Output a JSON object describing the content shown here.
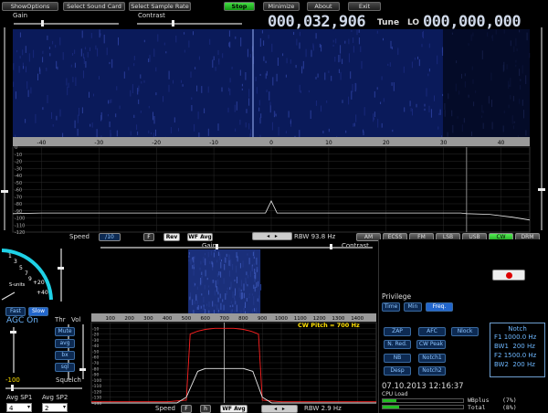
{
  "toolbar": {
    "show_options": "ShowOptions",
    "select_sound_card": "Select Sound Card",
    "select_sample_rate": "Select Sample Rate",
    "stop": "Stop",
    "minimize": "Minimize",
    "about": "About",
    "exit": "Exit"
  },
  "top": {
    "gain_label": "Gain",
    "contrast_label": "Contrast",
    "tune_value": "000,032,906",
    "tune_label": "Tune",
    "lo_label": "LO",
    "lo_value": "000,000,000"
  },
  "main_axis_labels": [
    "-40",
    "-30",
    "-20",
    "-10",
    "0",
    "10",
    "20",
    "30",
    "40"
  ],
  "main_db_labels": [
    "0",
    "-10",
    "-20",
    "-30",
    "-40",
    "-50",
    "-60",
    "-70",
    "-80",
    "-90",
    "-100",
    "-110",
    "-120"
  ],
  "mid": {
    "speed_label": "Speed",
    "speed_value": "/10",
    "f_label": "F",
    "rev_label": "Rev",
    "wfavg_label": "WF Avg",
    "rbw_label": "RBW 93.8 Hz"
  },
  "modes": [
    "AM",
    "ECSS",
    "FM",
    "LSB",
    "USB",
    "CW",
    "DRM"
  ],
  "active_mode": "CW",
  "lower": {
    "gain_label": "Gain",
    "contrast_label": "Contrast",
    "cw_pitch": "CW Pitch = 700 Hz",
    "speed_label": "Speed",
    "f_label": "F",
    "h_label": "h",
    "wfavg_label": "WF Avg",
    "rbw_label": "RBW 2.9 Hz"
  },
  "lower_axis": [
    "100",
    "200",
    "300",
    "400",
    "500",
    "600",
    "700",
    "800",
    "900",
    "1000",
    "1100",
    "1200",
    "1300",
    "1400"
  ],
  "lower_db": [
    "-10",
    "-20",
    "-30",
    "-40",
    "-50",
    "-60",
    "-70",
    "-80",
    "-90",
    "-100",
    "-110",
    "-120",
    "-130",
    "-140"
  ],
  "meter": {
    "ticks": [
      "1",
      "3",
      "5",
      "7",
      "9",
      "+20",
      "+40"
    ],
    "s_units": "S-units"
  },
  "agc": {
    "fast": "Fast",
    "slow": "Slow",
    "status": "AGC On"
  },
  "thr_label": "Thr",
  "vol_label": "Vol",
  "dsp_buttons": [
    "Mute",
    "avg",
    "bx",
    "sql"
  ],
  "squelch_label": "Squelch",
  "squelch_value": "-100",
  "avg": {
    "sp1_label": "Avg SP1",
    "sp2_label": "Avg SP2",
    "sp1_value": "4",
    "sp2_value": "2"
  },
  "privilege": {
    "title": "Privilege",
    "options": [
      "Time",
      "Min",
      "Freq."
    ],
    "active": "Freq."
  },
  "nr_buttons": [
    "ZAP",
    "AFC",
    "Nlock",
    "N. Red.",
    "CW Peak",
    "NB",
    "Notch1",
    "Desp",
    "Notch2"
  ],
  "notch": {
    "title": "Notch",
    "lines": [
      "F1 1000.0 Hz",
      "BW1  200 Hz",
      "F2 1500.0 Hz",
      "BW2  200 Hz"
    ]
  },
  "status": {
    "datetime": "07.10.2013 12:16:37",
    "cpu_label": "CPU Load",
    "wbplus": "WBplus",
    "wbplus_pct": "(7%)",
    "total": "Total",
    "total_pct": "(8%)",
    "wbplus_level": 0.07,
    "total_level": 0.08
  },
  "colors": {
    "waterfall": "#0a1a5a",
    "accent_green": "#22bb22",
    "accent_blue": "#2266cc",
    "trace_red": "#ff2020"
  },
  "chart_data": [
    {
      "type": "line",
      "xlim": [
        -45,
        45
      ],
      "ylim": [
        -120,
        0
      ],
      "x": [
        -45,
        -40,
        -35,
        -30,
        -25,
        -20,
        -15,
        -10,
        -5,
        -1,
        0,
        1,
        5,
        10,
        15,
        20,
        25,
        30,
        33,
        34,
        38,
        42,
        45
      ],
      "y": [
        -94,
        -93,
        -93,
        -93,
        -93,
        -93,
        -93,
        -93,
        -93,
        -93,
        -76,
        -93,
        -93,
        -93,
        -93,
        -93,
        -93,
        -93,
        -93,
        -94,
        -95,
        -99,
        -103
      ]
    },
    {
      "type": "line",
      "xlim": [
        0,
        1500
      ],
      "ylim": [
        -140,
        0
      ],
      "series": [
        {
          "x": [
            0,
            400,
            500,
            520,
            560,
            600,
            650,
            700,
            750,
            800,
            840,
            880,
            900,
            1000,
            1500
          ],
          "y": [
            -138,
            -138,
            -135,
            -20,
            -15,
            -12,
            -10,
            -10,
            -10,
            -12,
            -15,
            -20,
            -135,
            -138,
            -138
          ]
        },
        {
          "x": [
            0,
            450,
            500,
            560,
            600,
            700,
            800,
            850,
            900,
            950,
            1500
          ],
          "y": [
            -140,
            -140,
            -130,
            -85,
            -80,
            -80,
            -80,
            -85,
            -130,
            -140,
            -140
          ]
        }
      ]
    }
  ]
}
